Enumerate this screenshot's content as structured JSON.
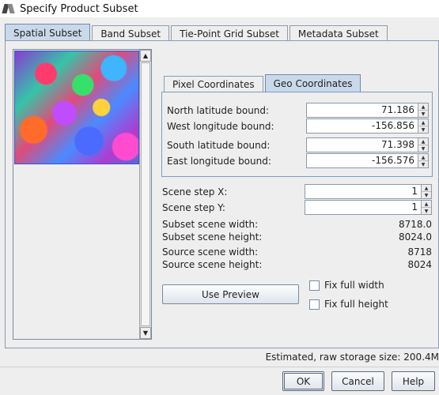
{
  "window": {
    "title": "Specify Product Subset"
  },
  "tabs": [
    "Spatial Subset",
    "Band Subset",
    "Tie-Point Grid Subset",
    "Metadata Subset"
  ],
  "active_tab": "Spatial Subset",
  "coord_tabs": [
    "Pixel Coordinates",
    "Geo Coordinates"
  ],
  "active_coord_tab": "Geo Coordinates",
  "geo": {
    "north_label": "North latitude bound:",
    "north_value": "71.186",
    "west_label": "West longitude bound:",
    "west_value": "-156.856",
    "south_label": "South latitude bound:",
    "south_value": "71.398",
    "east_label": "East longitude bound:",
    "east_value": "-156.576"
  },
  "scene": {
    "step_x_label": "Scene step X:",
    "step_x_value": "1",
    "step_y_label": "Scene step Y:",
    "step_y_value": "1",
    "subset_width_label": "Subset scene width:",
    "subset_width_value": "8718.0",
    "subset_height_label": "Subset scene height:",
    "subset_height_value": "8024.0",
    "source_width_label": "Source scene width:",
    "source_width_value": "8718",
    "source_height_label": "Source scene height:",
    "source_height_value": "8024"
  },
  "preview_button": "Use Preview",
  "fix_full_width": "Fix full width",
  "fix_full_height": "Fix full height",
  "storage_text": "Estimated, raw storage size: 200.4M",
  "buttons": {
    "ok": "OK",
    "cancel": "Cancel",
    "help": "Help"
  }
}
